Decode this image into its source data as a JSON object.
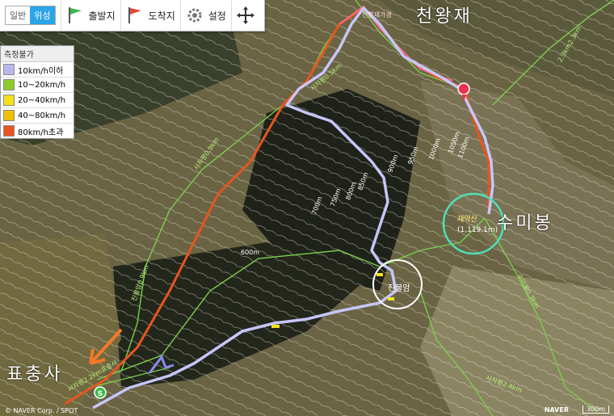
{
  "toolbar": {
    "map_type": [
      "일반",
      "위성"
    ],
    "start_label": "출발지",
    "end_label": "도착지",
    "settings_label": "설정",
    "colors": {
      "start_flag": "#3cb94a",
      "end_flag": "#e24b3b",
      "active_tab": "#2ba4e8"
    }
  },
  "legend": {
    "header": "측정불가",
    "items": [
      {
        "label": "10km/h이하",
        "color": "#b8b8f0"
      },
      {
        "label": "10~20km/h",
        "color": "#8fcc2a"
      },
      {
        "label": "20~40km/h",
        "color": "#f3e21b"
      },
      {
        "label": "40~80km/h",
        "color": "#f0c000"
      },
      {
        "label": "80km/h초과",
        "color": "#e8551e"
      }
    ]
  },
  "annotations": {
    "cheonwangjae": "천왕재",
    "sumibong": "수미봉",
    "pyochungsa": "표충사",
    "jinbulam": "진불암",
    "peak_label": "재약산",
    "peak_elev": "(1,119.1m)",
    "sign_top": "천황재가경"
  },
  "contours": [
    "600m",
    "700m",
    "750m",
    "800m",
    "850m",
    "900m",
    "950m",
    "1000m",
    "1050m",
    "1100m"
  ],
  "trail_labels": [
    "사자평0.5km",
    "사자평0.9km",
    "진불암0.9km",
    "2.3km2.3km",
    "사자평2.2km표충사",
    "수미봉0.3km",
    "사자평2.4km"
  ],
  "footer": {
    "copyright": "© NAVER Corp. / SPOT",
    "brand": "NAVER",
    "scale": "300m"
  }
}
